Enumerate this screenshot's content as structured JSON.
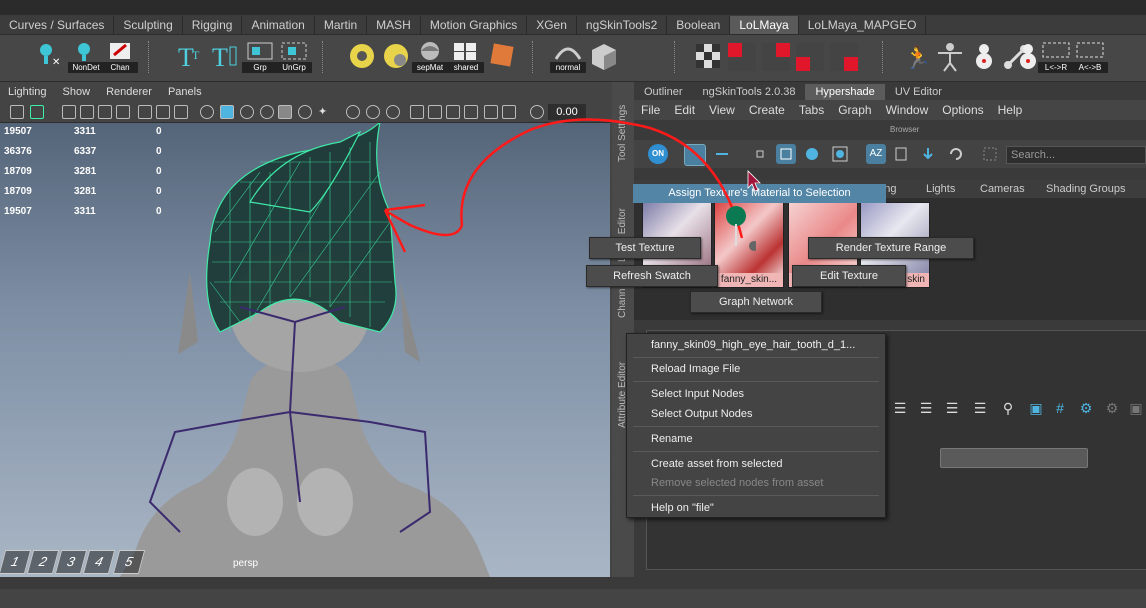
{
  "shelf_tabs": [
    "Curves / Surfaces",
    "Sculpting",
    "Rigging",
    "Animation",
    "Martin",
    "MASH",
    "Motion Graphics",
    "XGen",
    "ngSkinTools2",
    "Boolean",
    "LoLMaya",
    "LoLMaya_MAPGEO"
  ],
  "shelf_active_tab": "LoLMaya",
  "shelf_icons": {
    "nondet": "NonDet",
    "chan": "Chan",
    "grp": "Grp",
    "ungrp": "UnGrp",
    "sepmat": "sepMat",
    "shared": "shared",
    "normal": "normal",
    "lr": "L<->R",
    "ab": "A<->B"
  },
  "viewport": {
    "menu": [
      "Lighting",
      "Show",
      "Renderer",
      "Panels"
    ],
    "value": "0.00",
    "camera_label": "persp",
    "stats": [
      [
        "19507",
        "3311",
        "0"
      ],
      [
        "36376",
        "6337",
        "0"
      ],
      [
        "18709",
        "3281",
        "0"
      ],
      [
        "18709",
        "3281",
        "0"
      ],
      [
        "19507",
        "3311",
        "0"
      ]
    ],
    "hotkeys": [
      "1",
      "2",
      "3",
      "4",
      "5"
    ]
  },
  "side_labels": {
    "tool_settings": "Tool Settings",
    "layer_editor": "Layer Editor",
    "channel": "Chann",
    "attribute_editor": "Attribute Editor"
  },
  "panel_tabs": [
    "Outliner",
    "ngSkinTools 2.0.38",
    "Hypershade",
    "UV Editor"
  ],
  "panel_active_tab": "Hypershade",
  "hypershade": {
    "menu": [
      "File",
      "Edit",
      "View",
      "Create",
      "Tabs",
      "Graph",
      "Window",
      "Options",
      "Help"
    ],
    "browser_label": "Browser",
    "toggle": "ON",
    "search_placeholder": "Search...",
    "browser_tabs": [
      "ering",
      "Lights",
      "Cameras",
      "Shading Groups"
    ],
    "swatch_label": "fanny_skin...",
    "swatch_label_right": "skin",
    "swatch_label_cut": "f"
  },
  "assign_item": "Assign Texture's Material to Selection",
  "marking_menu": {
    "test_texture": "Test Texture",
    "render_texture_range": "Render Texture Range",
    "refresh_swatch": "Refresh Swatch",
    "edit_texture": "Edit Texture",
    "graph_network": "Graph Network"
  },
  "context_menu": {
    "header": "fanny_skin09_high_eye_hair_tooth_d_1...",
    "reload": "Reload Image File",
    "select_input": "Select Input Nodes",
    "select_output": "Select Output Nodes",
    "rename": "Rename",
    "create_asset": "Create asset from selected",
    "remove_nodes": "Remove selected nodes from asset",
    "help": "Help on \"file\""
  },
  "colors": {
    "wireframe": "#3df0a8",
    "annotation": "#ff1a1a",
    "highlight": "#5285a6",
    "active_tab": "#5a5a5a"
  }
}
